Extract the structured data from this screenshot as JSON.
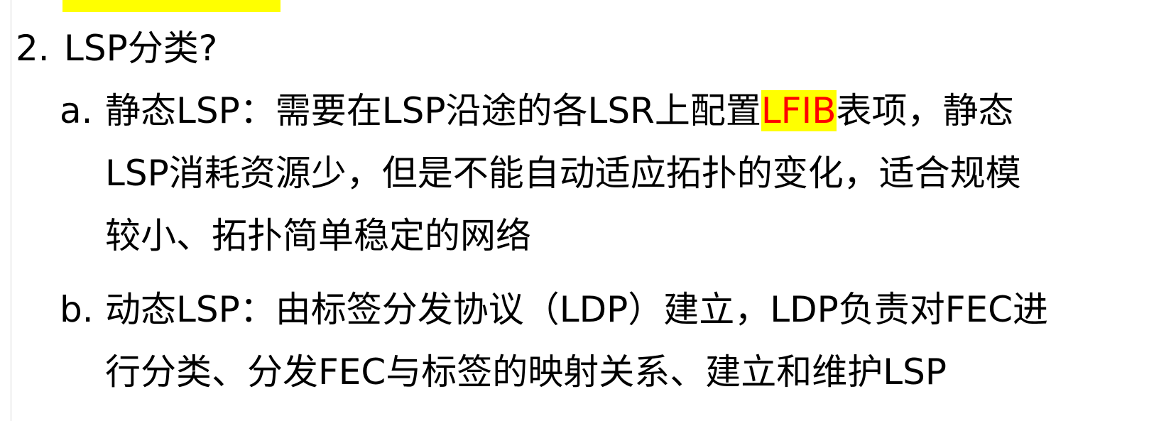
{
  "top_fragment": "",
  "heading": {
    "number": "2.",
    "text": "LSP分类?"
  },
  "items": [
    {
      "marker": "a.",
      "line1_before": "静态LSP：需要在LSP沿途的各LSR上配置",
      "line1_highlight": "LFIB",
      "line1_after": "表项，静态",
      "line2": "LSP消耗资源少，但是不能自动适应拓扑的变化，适合规模",
      "line3": "较小、拓扑简单稳定的网络"
    },
    {
      "marker": "b.",
      "line1": "动态LSP：由标签分发协议（LDP）建立，LDP负责对FEC进",
      "line2": "行分类、分发FEC与标签的映射关系、建立和维护LSP"
    }
  ],
  "colors": {
    "highlight_background": "#ffff00",
    "highlight_text": "#ff0000",
    "text": "#000000",
    "background": "#ffffff"
  }
}
